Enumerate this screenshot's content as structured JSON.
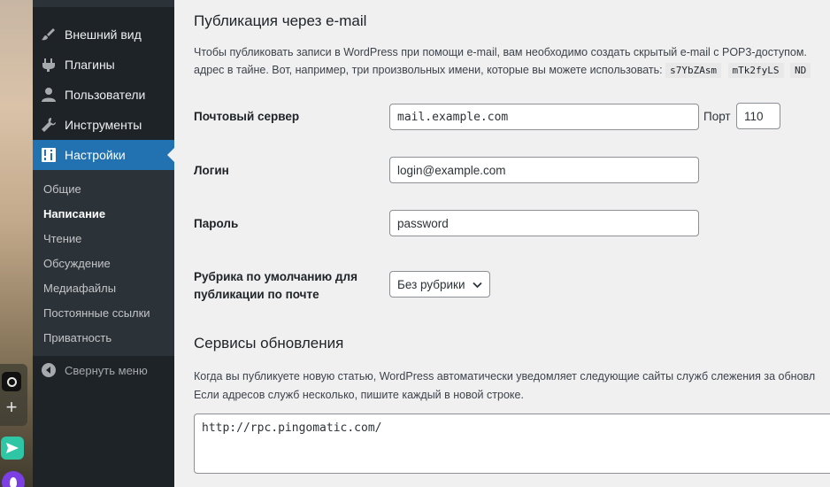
{
  "sidebar": {
    "items": [
      {
        "label": "Внешний вид",
        "icon": "paintbrush-icon"
      },
      {
        "label": "Плагины",
        "icon": "plugin-icon"
      },
      {
        "label": "Пользователи",
        "icon": "users-icon"
      },
      {
        "label": "Инструменты",
        "icon": "wrench-icon"
      },
      {
        "label": "Настройки",
        "icon": "settings-icon"
      }
    ],
    "submenu": [
      "Общие",
      "Написание",
      "Чтение",
      "Обсуждение",
      "Медиафайлы",
      "Постоянные ссылки",
      "Приватность"
    ],
    "collapse_label": "Свернуть меню"
  },
  "email_publish": {
    "title": "Публикация через e-mail",
    "desc_line1": "Чтобы публиковать записи в WordPress при помощи e-mail, вам необходимо создать скрытый e-mail с POP3-доступом.",
    "desc_line2": "адрес в тайне. Вот, например, три произвольных имени, которые вы можете использовать:",
    "codes": [
      "s7YbZAsm",
      "mTk2fyLS",
      "ND"
    ],
    "mail_server_label": "Почтовый сервер",
    "mail_server_value": "mail.example.com",
    "port_label": "Порт",
    "port_value": "110",
    "login_label": "Логин",
    "login_value": "login@example.com",
    "password_label": "Пароль",
    "password_value": "password",
    "category_label": "Рубрика по умолчанию для публикации по почте",
    "category_value": "Без рубрики"
  },
  "update_services": {
    "title": "Сервисы обновления",
    "desc_line1": "Когда вы публикуете новую статью, WordPress автоматически уведомляет следующие сайты служб слежения за обновл",
    "desc_line2": "Если адресов служб несколько, пишите каждый в новой строке.",
    "ping_value": "http://rpc.pingomatic.com/"
  },
  "colors": {
    "menu_bg": "#1d2327",
    "submenu_bg": "#2c3338",
    "accent": "#2271b1",
    "content_bg": "#f0f0f1"
  }
}
